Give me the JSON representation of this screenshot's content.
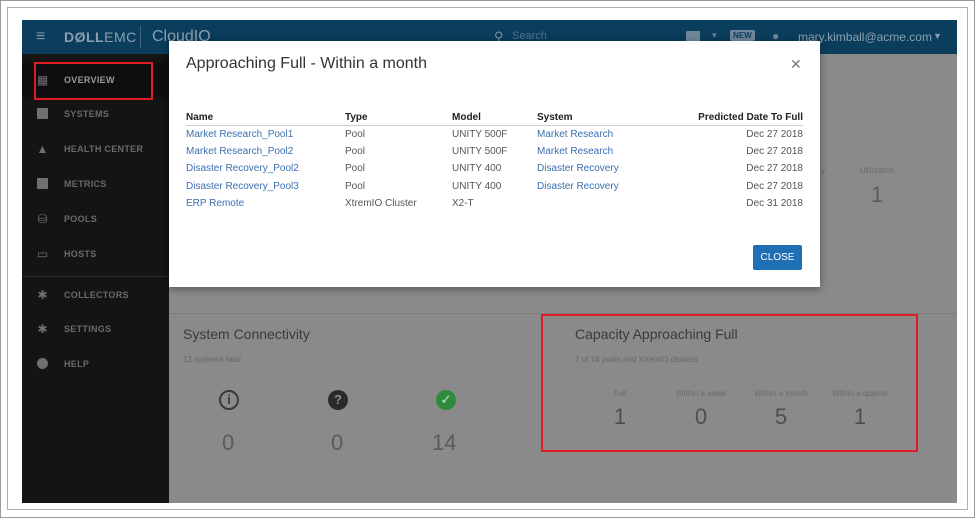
{
  "header": {
    "brand_bold": "DØLL",
    "brand_light": "EMC",
    "product": "CloudIQ",
    "search_placeholder": "Search",
    "new_badge": "NEW",
    "user_email": "mary.kimball@acme.com"
  },
  "sidebar": {
    "items": [
      {
        "label": "OVERVIEW",
        "icon": "dashboard-icon"
      },
      {
        "label": "SYSTEMS",
        "icon": "systems-icon"
      },
      {
        "label": "HEALTH CENTER",
        "icon": "bell-icon"
      },
      {
        "label": "METRICS",
        "icon": "chart-icon"
      },
      {
        "label": "POOLS",
        "icon": "database-icon"
      },
      {
        "label": "HOSTS",
        "icon": "monitor-icon"
      },
      {
        "label": "COLLECTORS",
        "icon": "gear-icon"
      },
      {
        "label": "SETTINGS",
        "icon": "gear-icon"
      },
      {
        "label": "HELP",
        "icon": "help-icon"
      }
    ]
  },
  "background": {
    "efficiency_fragment": "cy",
    "utilization_label": "Utilization",
    "utilization_value": "1",
    "connectivity": {
      "title": "System Connectivity",
      "subtitle": "12 systems total",
      "values": [
        "0",
        "0",
        "14"
      ]
    },
    "capacity": {
      "title": "Capacity Approaching Full",
      "subtitle": "7 of 14 pools and XtremIO clusters",
      "stats": [
        {
          "label": "Full",
          "value": "1"
        },
        {
          "label": "Within a week",
          "value": "0"
        },
        {
          "label": "Within a month",
          "value": "5"
        },
        {
          "label": "Within a quarter",
          "value": "1"
        }
      ]
    }
  },
  "modal": {
    "title": "Approaching Full - Within a month",
    "close_label": "CLOSE",
    "columns": [
      "Name",
      "Type",
      "Model",
      "System",
      "Predicted Date To Full"
    ],
    "rows": [
      [
        "Market Research_Pool1",
        "Pool",
        "UNITY 500F",
        "Market Research",
        "Dec 27 2018"
      ],
      [
        "Market Research_Pool2",
        "Pool",
        "UNITY 500F",
        "Market Research",
        "Dec 27 2018"
      ],
      [
        "Disaster Recovery_Pool2",
        "Pool",
        "UNITY 400",
        "Disaster Recovery",
        "Dec 27 2018"
      ],
      [
        "Disaster Recovery_Pool3",
        "Pool",
        "UNITY 400",
        "Disaster Recovery",
        "Dec 27 2018"
      ],
      [
        "ERP Remote",
        "XtremIO Cluster",
        "X2-T",
        "",
        "Dec 31 2018"
      ]
    ]
  },
  "colors": {
    "topbar": "#0b3d5c",
    "sidebar": "#141414",
    "link": "#3a6fb0",
    "primary_button": "#1f6fb4",
    "highlight": "#e01b24",
    "ok_green": "#2e8b3a"
  }
}
